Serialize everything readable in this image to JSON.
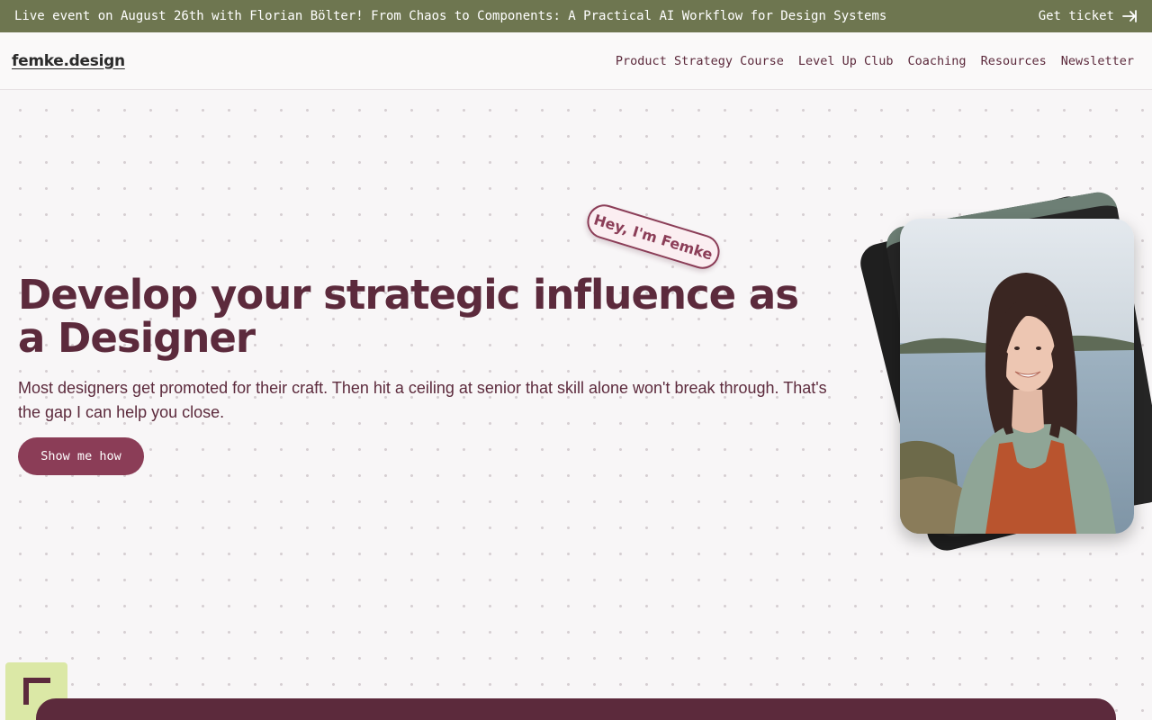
{
  "announcement": {
    "text": "Live event on August 26th with Florian Bölter! From Chaos to Components: A Practical AI Workflow for Design Systems",
    "cta_label": "Get ticket",
    "cta_icon": "arrow-right-icon"
  },
  "header": {
    "logo": "femke.design",
    "nav": [
      {
        "label": "Product Strategy Course"
      },
      {
        "label": "Level Up Club"
      },
      {
        "label": "Coaching"
      },
      {
        "label": "Resources"
      },
      {
        "label": "Newsletter"
      }
    ]
  },
  "hero": {
    "tag": "Hey, I'm Femke",
    "title": "Develop your strategic influence as a Designer",
    "subtitle": "Most designers get promoted for their craft. Then hit a ceiling at senior that skill alone won't break through. That's the gap I can help you close.",
    "cta_label": "Show me how",
    "portrait_icon": "portrait-photo"
  },
  "colors": {
    "banner": "#6e7650",
    "brand": "#5c2a3c",
    "button": "#8b3d57",
    "badge": "#dbe8a6"
  }
}
